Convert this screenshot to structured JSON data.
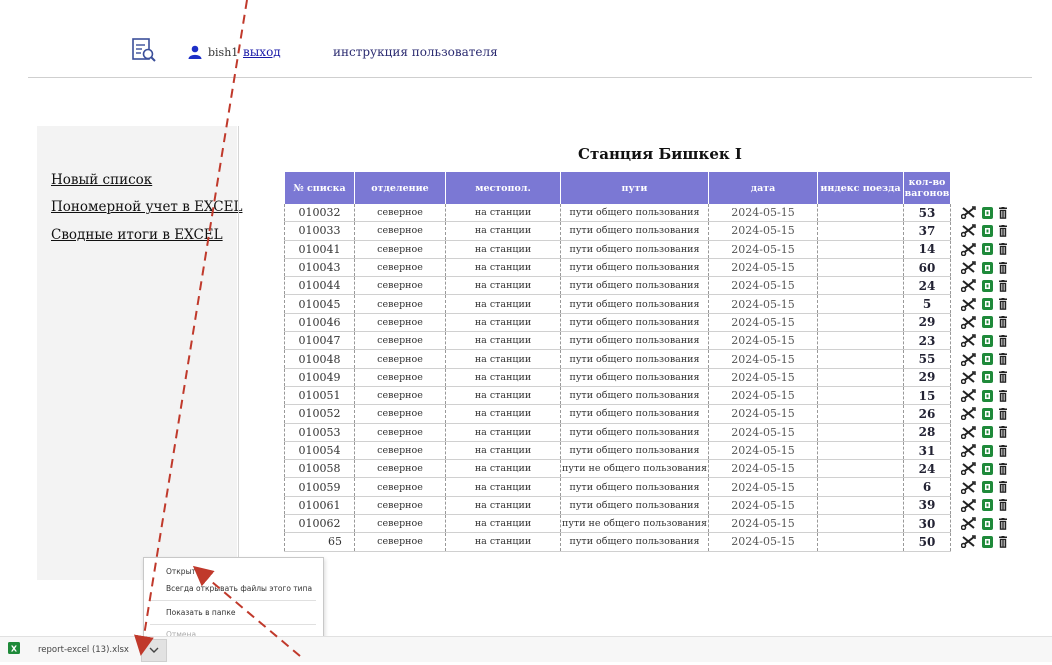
{
  "header": {
    "username": "bish1",
    "logout_label": "выход",
    "manual_label": "инструкция пользователя"
  },
  "sidebar": {
    "items": [
      {
        "label": "Новый список"
      },
      {
        "label": "Пономерной учет в EXCEL"
      },
      {
        "label": "Сводные итоги в EXCEL"
      }
    ]
  },
  "station_title": "Станция Бишкек I",
  "table": {
    "headers": [
      "№ списка",
      "отделение",
      "местопол.",
      "пути",
      "дата",
      "индекс поезда",
      "кол-во вагонов"
    ],
    "rows": [
      [
        "010032",
        "северное",
        "на станции",
        "пути общего пользования",
        "2024-05-15",
        "",
        "53"
      ],
      [
        "010033",
        "северное",
        "на станции",
        "пути общего пользования",
        "2024-05-15",
        "",
        "37"
      ],
      [
        "010041",
        "северное",
        "на станции",
        "пути общего пользования",
        "2024-05-15",
        "",
        "14"
      ],
      [
        "010043",
        "северное",
        "на станции",
        "пути общего пользования",
        "2024-05-15",
        "",
        "60"
      ],
      [
        "010044",
        "северное",
        "на станции",
        "пути общего пользования",
        "2024-05-15",
        "",
        "24"
      ],
      [
        "010045",
        "северное",
        "на станции",
        "пути общего пользования",
        "2024-05-15",
        "",
        "5"
      ],
      [
        "010046",
        "северное",
        "на станции",
        "пути общего пользования",
        "2024-05-15",
        "",
        "29"
      ],
      [
        "010047",
        "северное",
        "на станции",
        "пути общего пользования",
        "2024-05-15",
        "",
        "23"
      ],
      [
        "010048",
        "северное",
        "на станции",
        "пути общего пользования",
        "2024-05-15",
        "",
        "55"
      ],
      [
        "010049",
        "северное",
        "на станции",
        "пути общего пользования",
        "2024-05-15",
        "",
        "29"
      ],
      [
        "010051",
        "северное",
        "на станции",
        "пути общего пользования",
        "2024-05-15",
        "",
        "15"
      ],
      [
        "010052",
        "северное",
        "на станции",
        "пути общего пользования",
        "2024-05-15",
        "",
        "26"
      ],
      [
        "010053",
        "северное",
        "на станции",
        "пути общего пользования",
        "2024-05-15",
        "",
        "28"
      ],
      [
        "010054",
        "северное",
        "на станции",
        "пути общего пользования",
        "2024-05-15",
        "",
        "31"
      ],
      [
        "010058",
        "северное",
        "на станции",
        "пути не общего пользования",
        "2024-05-15",
        "",
        "24"
      ],
      [
        "010059",
        "северное",
        "на станции",
        "пути общего пользования",
        "2024-05-15",
        "",
        "6"
      ],
      [
        "010061",
        "северное",
        "на станции",
        "пути общего пользования",
        "2024-05-15",
        "",
        "39"
      ],
      [
        "010062",
        "северное",
        "на станции",
        "пути не общего пользования",
        "2024-05-15",
        "",
        "30"
      ],
      [
        "65",
        "северное",
        "на станции",
        "пути общего пользования",
        "2024-05-15",
        "",
        "50"
      ]
    ]
  },
  "context_menu": {
    "items": [
      "Открыть",
      "Всегда открывать файлы этого типа",
      "Показать в папке",
      "Отмена"
    ]
  },
  "download": {
    "filename": "report-excel (13).xlsx"
  },
  "colors": {
    "table_header_bg": "#7b78d4",
    "excel_green": "#1f8a3a",
    "arrow_red": "#c0392b"
  },
  "icons": {
    "row_actions": [
      "tools-icon",
      "excel-icon",
      "trash-icon"
    ],
    "header": [
      "report-search-icon",
      "user-icon"
    ]
  }
}
